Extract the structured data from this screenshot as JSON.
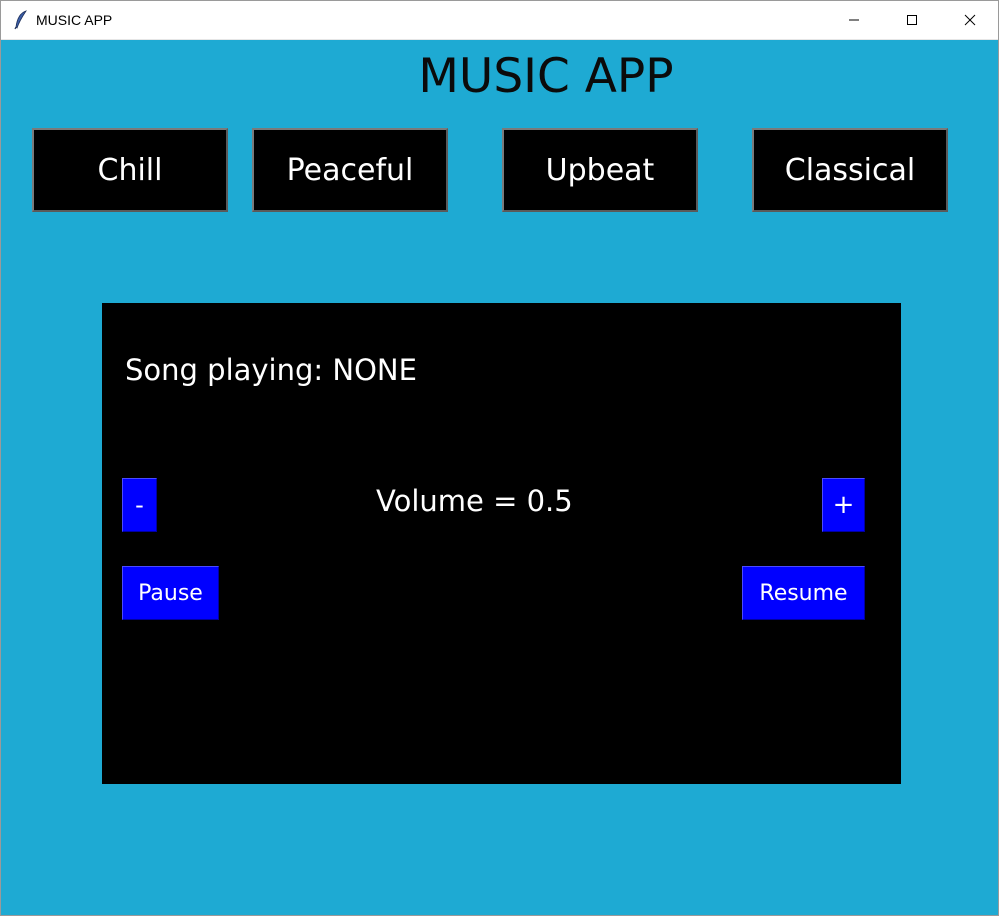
{
  "window": {
    "title": "MUSIC APP",
    "controls": {
      "minimize_icon": "minimize-icon",
      "maximize_icon": "maximize-icon",
      "close_icon": "close-icon"
    }
  },
  "header": {
    "title": "MUSIC APP"
  },
  "genres": [
    {
      "label": "Chill"
    },
    {
      "label": "Peaceful"
    },
    {
      "label": "Upbeat"
    },
    {
      "label": "Classical"
    }
  ],
  "player": {
    "song_playing": "Song playing: NONE",
    "volume": "Volume = 0.5",
    "volume_down_label": "-",
    "volume_up_label": "+",
    "pause_label": "Pause",
    "resume_label": "Resume"
  },
  "colors": {
    "background": "#1eaad3",
    "panel": "#000000",
    "control_button": "#0000ff",
    "genre_button": "#000000"
  }
}
